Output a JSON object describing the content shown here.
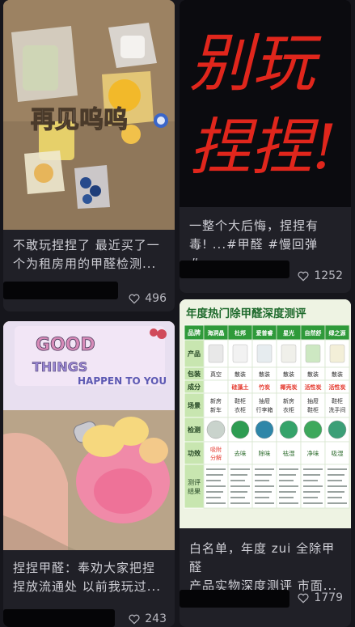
{
  "feed": {
    "cards": [
      {
        "overlay_text": "再见呜呜",
        "title": "不敢玩捏捏了 最近买了一\n个为租房用的甲醛检测...",
        "likes": "496"
      },
      {
        "overlay_text": "别玩\n捏捏!",
        "title": "一整个大后悔，捏捏有\n毒!  ...#甲醛 #慢回弹 #...",
        "likes": "1252"
      },
      {
        "overlay_text": "GOOD THINGS HAPPEN TO YOU",
        "title": "捏捏甲醛：奉劝大家把捏\n捏放流通处 以前我玩过...",
        "likes": "243"
      },
      {
        "overlay_text": "年度热门除甲醛深度测评",
        "title": "白名单，年度 zui 全除甲醛\n产品实物深度测评 市面...",
        "likes": "1779",
        "table": {
          "row_labels": [
            "品牌",
            "产品",
            "包装",
            "成分",
            "场景",
            "检测",
            "功效",
            "测评结果"
          ],
          "brands": [
            "海洞晶",
            "杜邦",
            "爱普睿",
            "星光",
            "自然舒",
            "绿之源"
          ],
          "packaging": [
            "真空",
            "散装",
            "散装",
            "散装",
            "散装",
            "散装"
          ],
          "ingredients": [
            "",
            "硅藻土",
            "竹炭",
            "椰壳炭",
            "活性炭",
            "活性炭"
          ],
          "scenes": [
            "新房\n新车",
            "鞋柜\n衣柜",
            "抽屉\n行李箱",
            "新房\n衣柜",
            "抽屉\n鞋柜",
            "鞋柜\n洗手间"
          ],
          "effects": [
            "吸附\n分解",
            "去味",
            "除味",
            "祛湿",
            "净味",
            "吸湿"
          ],
          "colors": {
            "header_green": "#2f9a3a",
            "title_red": "#e53a2e",
            "row_label_bg": "#c8e6b0",
            "detect_colors": [
              "#c9d3cc",
              "#2e9c52",
              "#2f86a8",
              "#35a36a",
              "#3ea85c",
              "#3c9f77"
            ]
          }
        }
      }
    ]
  }
}
